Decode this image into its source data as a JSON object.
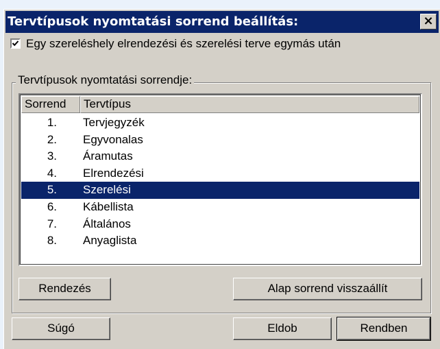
{
  "dialog": {
    "title": "Tervtípusok nyomtatási sorrend beállítás:",
    "close_label": "×"
  },
  "checkbox": {
    "label": "Egy szereléshely elrendezési és szerelési terve egymás után",
    "checked": true
  },
  "group": {
    "label": "Tervtípusok nyomtatási sorrendje:"
  },
  "table": {
    "columns": [
      "Sorrend",
      "Tervtípus"
    ],
    "rows": [
      {
        "num": "1.",
        "name": "Tervjegyzék"
      },
      {
        "num": "2.",
        "name": "Egyvonalas"
      },
      {
        "num": "3.",
        "name": "Áramutas"
      },
      {
        "num": "4.",
        "name": "Elrendezési"
      },
      {
        "num": "5.",
        "name": "Szerelési"
      },
      {
        "num": "6.",
        "name": "Kábellista"
      },
      {
        "num": "7.",
        "name": "Általános"
      },
      {
        "num": "8.",
        "name": "Anyaglista"
      }
    ],
    "selected_index": 4
  },
  "buttons": {
    "sort": "Rendezés",
    "reset": "Alap sorrend visszaállít",
    "help": "Súgó",
    "discard": "Eldob",
    "ok": "Rendben"
  },
  "colors": {
    "titlebar": "#0a246a",
    "selection": "#0a246a",
    "face": "#d4d0c8",
    "outer_background": "#eaf2fb"
  }
}
